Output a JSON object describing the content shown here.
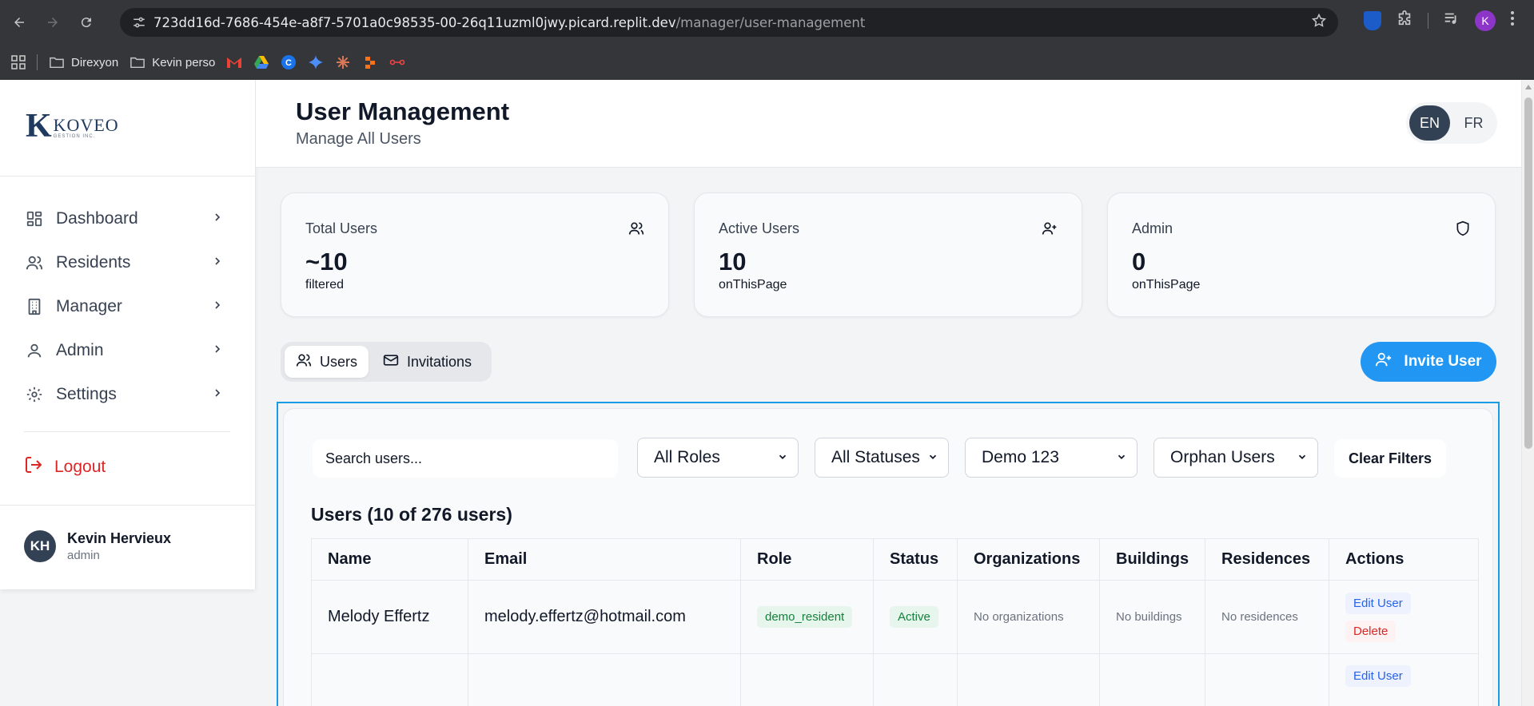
{
  "browser": {
    "url_host": "723dd16d-7686-454e-a8f7-5701a0c98535-00-26q11uzml0jwy.picard.replit.dev",
    "url_path": "/manager/user-management",
    "profile_initial": "K",
    "bookmarks": [
      {
        "label": "",
        "icon": "apps-grid-icon"
      },
      {
        "label": "Direxyon",
        "icon": "folder-icon"
      },
      {
        "label": "Kevin perso",
        "icon": "folder-icon"
      }
    ]
  },
  "sidebar": {
    "logo_letter": "K",
    "logo_word": "KOVEO",
    "logo_sub": "GESTION INC.",
    "items": [
      {
        "label": "Dashboard",
        "icon": "dashboard-icon"
      },
      {
        "label": "Residents",
        "icon": "users-icon"
      },
      {
        "label": "Manager",
        "icon": "building-icon"
      },
      {
        "label": "Admin",
        "icon": "user-icon"
      },
      {
        "label": "Settings",
        "icon": "gear-icon"
      }
    ],
    "logout_label": "Logout",
    "user": {
      "initials": "KH",
      "name": "Kevin Hervieux",
      "role": "admin"
    }
  },
  "header": {
    "title": "User Management",
    "subtitle": "Manage All Users",
    "lang_en": "EN",
    "lang_fr": "FR"
  },
  "stats": [
    {
      "title": "Total Users",
      "value": "~10",
      "sub": "filtered",
      "icon": "users-icon"
    },
    {
      "title": "Active Users",
      "value": "10",
      "sub": "onThisPage",
      "icon": "user-plus-icon"
    },
    {
      "title": "Admin",
      "value": "0",
      "sub": "onThisPage",
      "icon": "shield-icon"
    }
  ],
  "tabs": {
    "users": "Users",
    "invitations": "Invitations"
  },
  "invite_label": "Invite User",
  "filters": {
    "search_placeholder": "Search users...",
    "roles": "All Roles",
    "statuses": "All Statuses",
    "organization": "Demo 123",
    "orphan": "Orphan Users",
    "clear": "Clear Filters"
  },
  "table": {
    "title": "Users (10 of 276 users)",
    "headers": [
      "Name",
      "Email",
      "Role",
      "Status",
      "Organizations",
      "Buildings",
      "Residences",
      "Actions"
    ],
    "rows": [
      {
        "name": "Melody Effertz",
        "email": "melody.effertz@hotmail.com",
        "role": "demo_resident",
        "status": "Active",
        "organizations": "No organizations",
        "buildings": "No buildings",
        "residences": "No residences",
        "edit": "Edit User",
        "delete": "Delete"
      },
      {
        "name": "",
        "email": "",
        "role": "",
        "status": "",
        "organizations": "",
        "buildings": "",
        "residences": "",
        "edit": "Edit User",
        "delete": ""
      }
    ]
  }
}
